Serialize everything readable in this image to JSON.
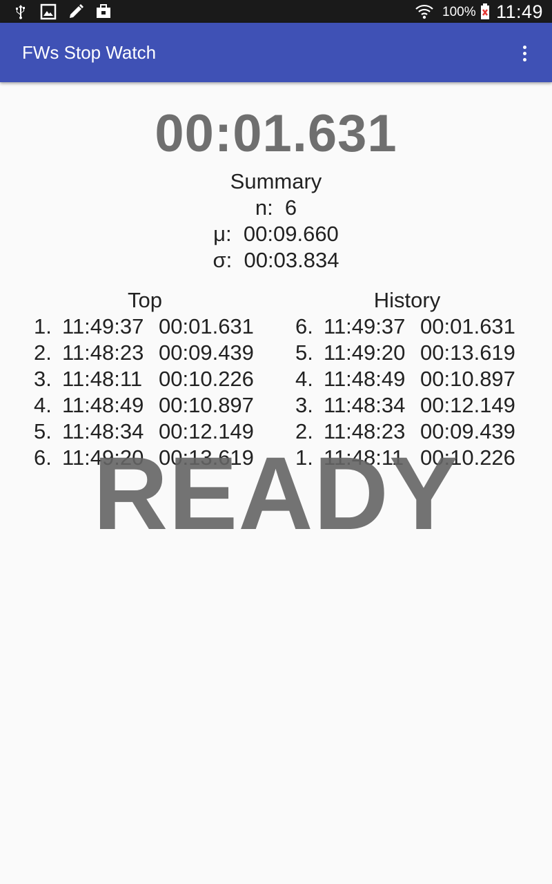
{
  "status_bar": {
    "icons": [
      "usb-icon",
      "image-icon",
      "edit-icon",
      "briefcase-icon",
      "wifi-icon",
      "battery-icon"
    ],
    "battery": "100%",
    "time": "11:49"
  },
  "app_bar": {
    "title": "FWs Stop Watch",
    "color": "#3f51b5"
  },
  "timer": "00:01.631",
  "summary": {
    "heading": "Summary",
    "n_label": "n:",
    "n_value": "6",
    "mu_label": "μ:",
    "mu_value": "00:09.660",
    "sigma_label": "σ:",
    "sigma_value": "00:03.834"
  },
  "top": {
    "header": "Top",
    "entries": [
      {
        "idx": "1.",
        "clock": "11:49:37",
        "elapsed": "00:01.631"
      },
      {
        "idx": "2.",
        "clock": "11:48:23",
        "elapsed": "00:09.439"
      },
      {
        "idx": "3.",
        "clock": "11:48:11",
        "elapsed": "00:10.226"
      },
      {
        "idx": "4.",
        "clock": "11:48:49",
        "elapsed": "00:10.897"
      },
      {
        "idx": "5.",
        "clock": "11:48:34",
        "elapsed": "00:12.149"
      },
      {
        "idx": "6.",
        "clock": "11:49:20",
        "elapsed": "00:13.619"
      }
    ]
  },
  "history": {
    "header": "History",
    "entries": [
      {
        "idx": "6.",
        "clock": "11:49:37",
        "elapsed": "00:01.631"
      },
      {
        "idx": "5.",
        "clock": "11:49:20",
        "elapsed": "00:13.619"
      },
      {
        "idx": "4.",
        "clock": "11:48:49",
        "elapsed": "00:10.897"
      },
      {
        "idx": "3.",
        "clock": "11:48:34",
        "elapsed": "00:12.149"
      },
      {
        "idx": "2.",
        "clock": "11:48:23",
        "elapsed": "00:09.439"
      },
      {
        "idx": "1.",
        "clock": "11:48:11",
        "elapsed": "00:10.226"
      }
    ]
  },
  "state_label": "READY"
}
